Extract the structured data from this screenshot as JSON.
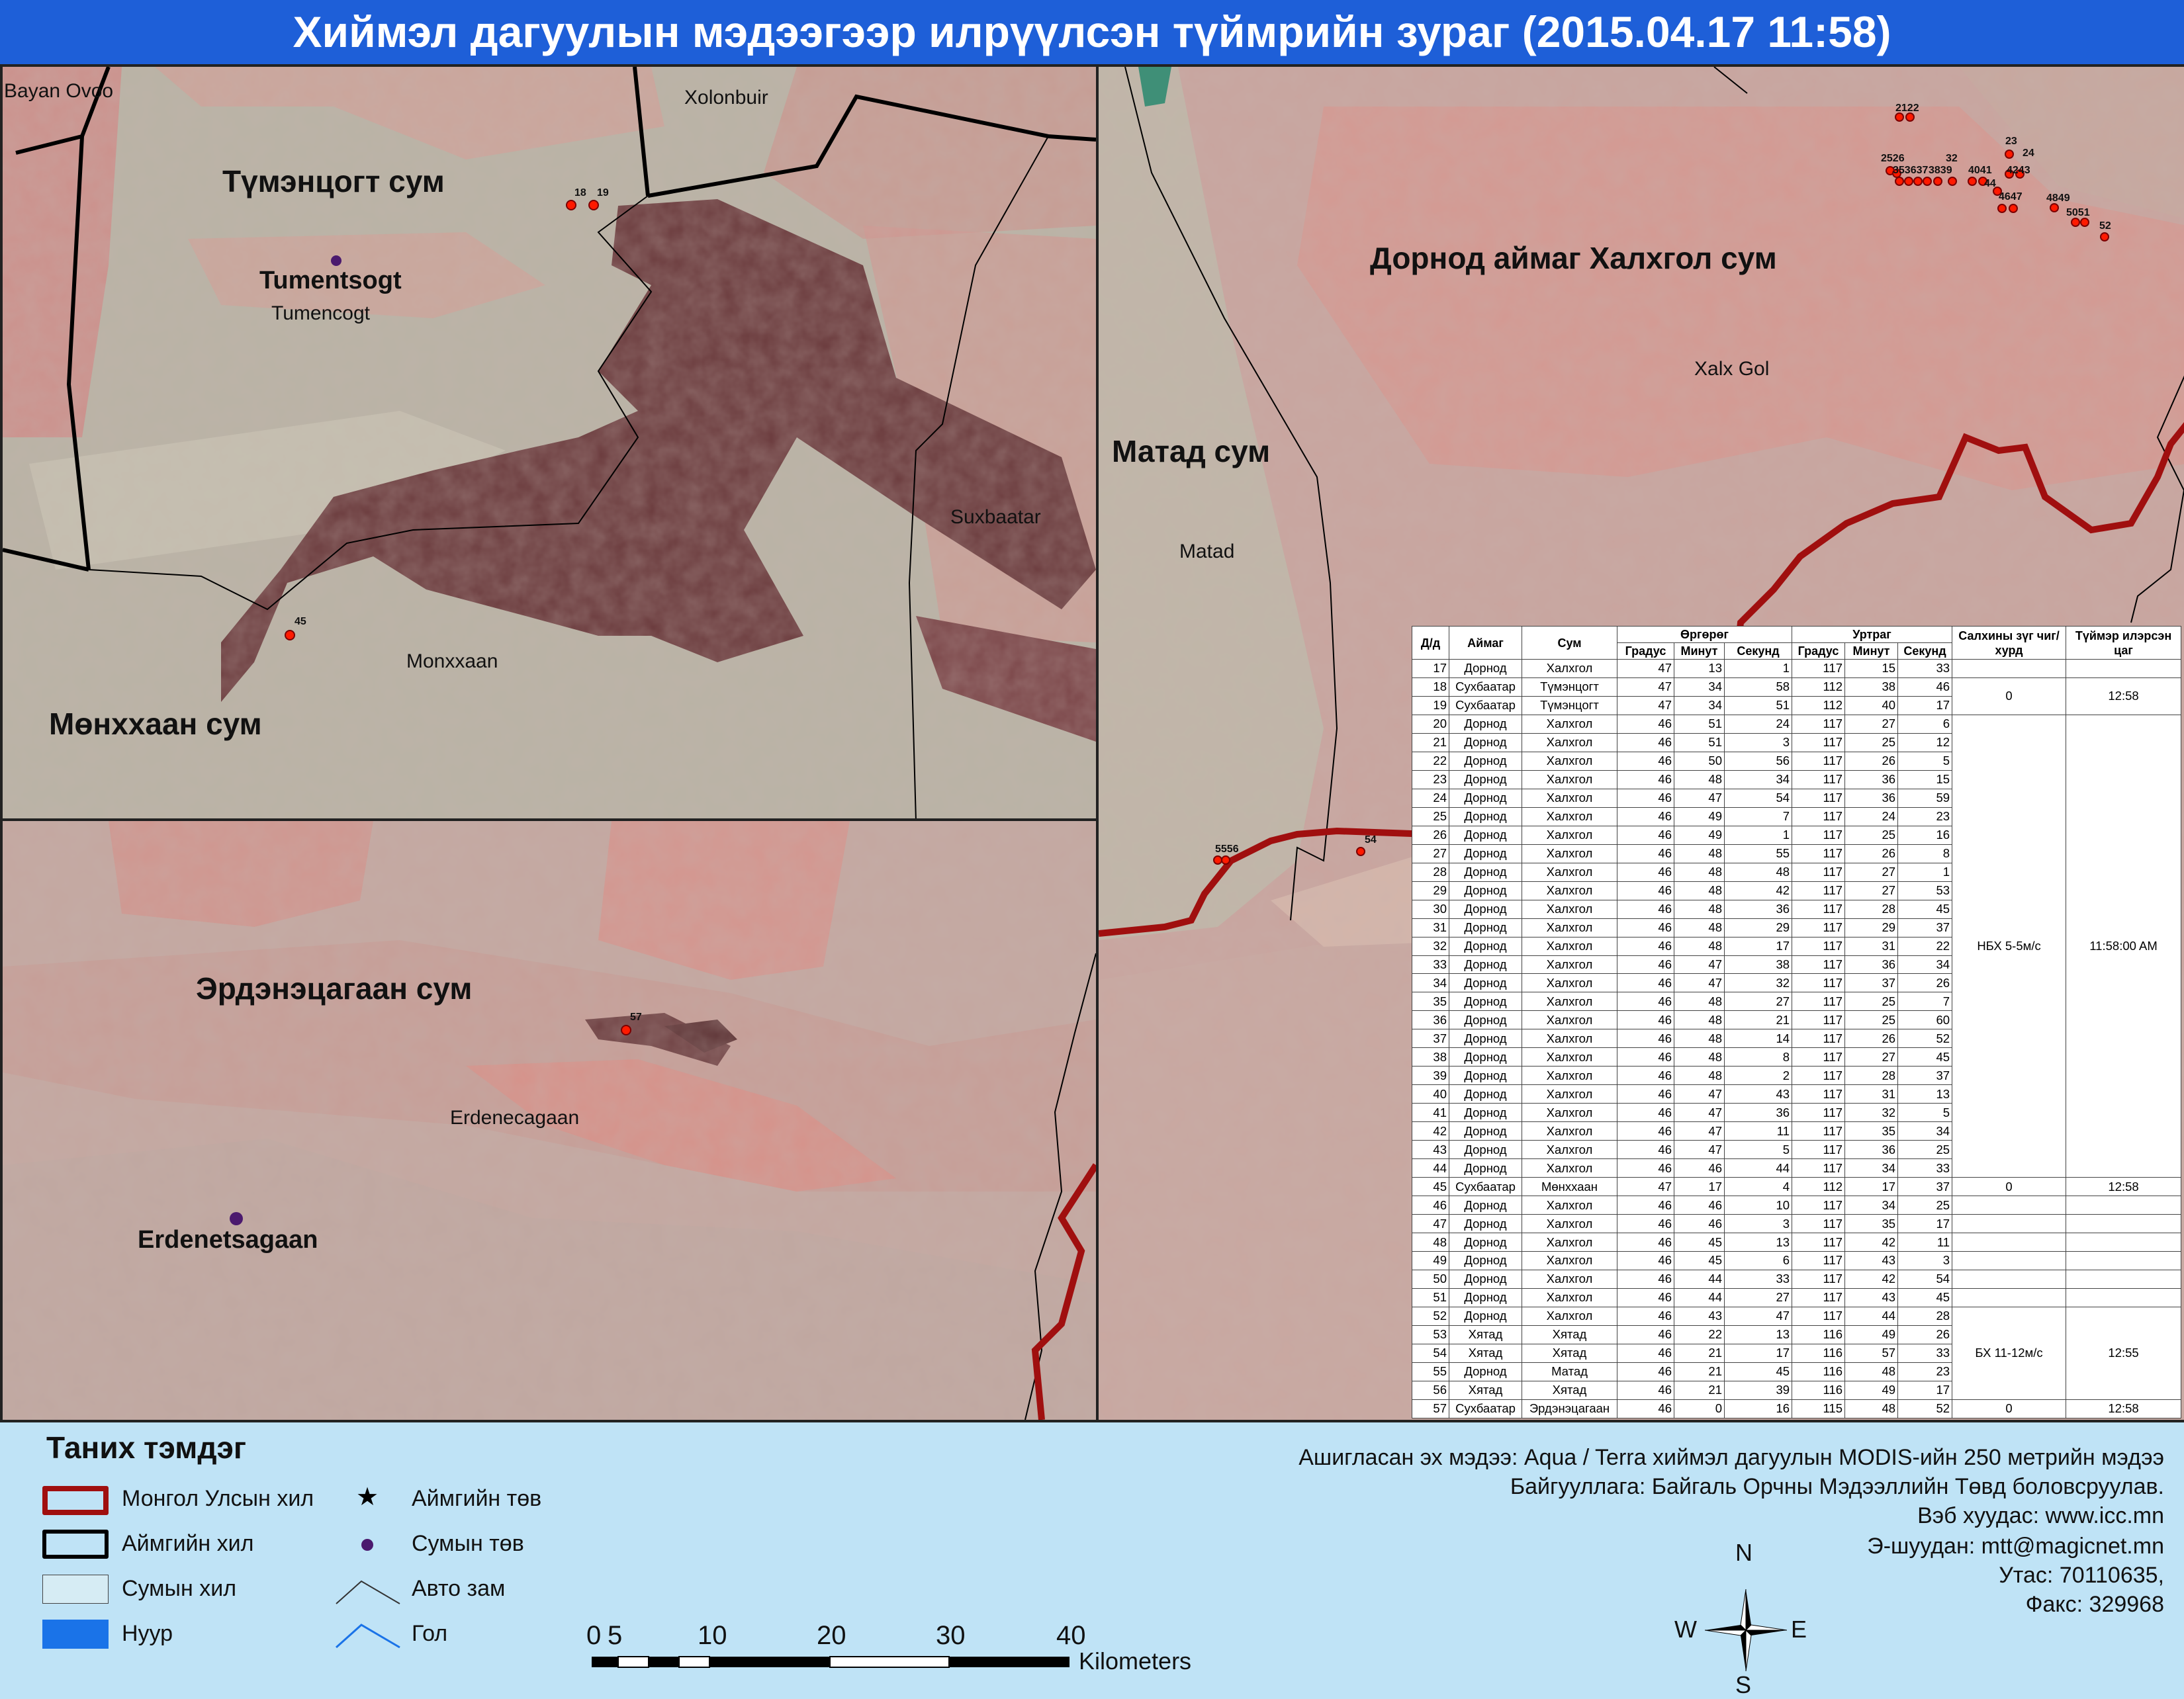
{
  "title": "Хиймэл дагуулын мэдээгээр илрүүлсэн түймрийн зураг  (2015.04.17 11:58)",
  "panel_tl": {
    "sum_tumentsogt": "Түмэнцогт сум",
    "sum_monkhkhaan": "Мөнххаан сум",
    "bayan_ovoo": "Bayan Ovoo",
    "xolonbuir": "Xolonbuir",
    "tumentsogt": "Tumentsogt",
    "tumencogt": "Tumencogt",
    "suxbaatar": "Suxbaatar",
    "monxxaan": "Monxxaan",
    "fires": [
      "18",
      "19",
      "45"
    ]
  },
  "panel_bl": {
    "sum_erdenetsagaan": "Эрдэнэцагаан сум",
    "erdenecagaan": "Erdenecagaan",
    "erdenetsagaan": "Erdenetsagaan",
    "fires": [
      "57"
    ]
  },
  "panel_r": {
    "sum_dornod": "Дорнод  аймаг Халхгол сум",
    "sum_matad": "Матад сум",
    "xalx_gol": "Xalx Gol",
    "matad": "Matad",
    "fires": [
      "2122",
      "2526",
      "353637",
      "3839",
      "32",
      "4041",
      "23",
      "24",
      "4243",
      "44",
      "4647",
      "4849",
      "5051",
      "52",
      "5556",
      "54"
    ]
  },
  "table": {
    "headers": {
      "dd": "Д/д",
      "aimag": "Аймаг",
      "sum": "Сум",
      "lat": "Өргөрөг",
      "lon": "Уртраг",
      "deg": "Градус",
      "min": "Минут",
      "sec": "Секунд",
      "wind": "Салхины зүг чиг/хурд",
      "time": "Түймэр илэрсэн цаг"
    },
    "rows": [
      [
        "17",
        "Дорнод",
        "Халхгол",
        "47",
        "13",
        "1",
        "117",
        "15",
        "33"
      ],
      [
        "18",
        "Сухбаатар",
        "Түмэнцогт",
        "47",
        "34",
        "58",
        "112",
        "38",
        "46"
      ],
      [
        "19",
        "Сухбаатар",
        "Түмэнцогт",
        "47",
        "34",
        "51",
        "112",
        "40",
        "17"
      ],
      [
        "20",
        "Дорнод",
        "Халхгол",
        "46",
        "51",
        "24",
        "117",
        "27",
        "6"
      ],
      [
        "21",
        "Дорнод",
        "Халхгол",
        "46",
        "51",
        "3",
        "117",
        "25",
        "12"
      ],
      [
        "22",
        "Дорнод",
        "Халхгол",
        "46",
        "50",
        "56",
        "117",
        "26",
        "5"
      ],
      [
        "23",
        "Дорнод",
        "Халхгол",
        "46",
        "48",
        "34",
        "117",
        "36",
        "15"
      ],
      [
        "24",
        "Дорнод",
        "Халхгол",
        "46",
        "47",
        "54",
        "117",
        "36",
        "59"
      ],
      [
        "25",
        "Дорнод",
        "Халхгол",
        "46",
        "49",
        "7",
        "117",
        "24",
        "23"
      ],
      [
        "26",
        "Дорнод",
        "Халхгол",
        "46",
        "49",
        "1",
        "117",
        "25",
        "16"
      ],
      [
        "27",
        "Дорнод",
        "Халхгол",
        "46",
        "48",
        "55",
        "117",
        "26",
        "8"
      ],
      [
        "28",
        "Дорнод",
        "Халхгол",
        "46",
        "48",
        "48",
        "117",
        "27",
        "1"
      ],
      [
        "29",
        "Дорнод",
        "Халхгол",
        "46",
        "48",
        "42",
        "117",
        "27",
        "53"
      ],
      [
        "30",
        "Дорнод",
        "Халхгол",
        "46",
        "48",
        "36",
        "117",
        "28",
        "45"
      ],
      [
        "31",
        "Дорнод",
        "Халхгол",
        "46",
        "48",
        "29",
        "117",
        "29",
        "37"
      ],
      [
        "32",
        "Дорнод",
        "Халхгол",
        "46",
        "48",
        "17",
        "117",
        "31",
        "22"
      ],
      [
        "33",
        "Дорнод",
        "Халхгол",
        "46",
        "47",
        "38",
        "117",
        "36",
        "34"
      ],
      [
        "34",
        "Дорнод",
        "Халхгол",
        "46",
        "47",
        "32",
        "117",
        "37",
        "26"
      ],
      [
        "35",
        "Дорнод",
        "Халхгол",
        "46",
        "48",
        "27",
        "117",
        "25",
        "7"
      ],
      [
        "36",
        "Дорнод",
        "Халхгол",
        "46",
        "48",
        "21",
        "117",
        "25",
        "60"
      ],
      [
        "37",
        "Дорнод",
        "Халхгол",
        "46",
        "48",
        "14",
        "117",
        "26",
        "52"
      ],
      [
        "38",
        "Дорнод",
        "Халхгол",
        "46",
        "48",
        "8",
        "117",
        "27",
        "45"
      ],
      [
        "39",
        "Дорнод",
        "Халхгол",
        "46",
        "48",
        "2",
        "117",
        "28",
        "37"
      ],
      [
        "40",
        "Дорнод",
        "Халхгол",
        "46",
        "47",
        "43",
        "117",
        "31",
        "13"
      ],
      [
        "41",
        "Дорнод",
        "Халхгол",
        "46",
        "47",
        "36",
        "117",
        "32",
        "5"
      ],
      [
        "42",
        "Дорнод",
        "Халхгол",
        "46",
        "47",
        "11",
        "117",
        "35",
        "34"
      ],
      [
        "43",
        "Дорнод",
        "Халхгол",
        "46",
        "47",
        "5",
        "117",
        "36",
        "25"
      ],
      [
        "44",
        "Дорнод",
        "Халхгол",
        "46",
        "46",
        "44",
        "117",
        "34",
        "33"
      ],
      [
        "45",
        "Сухбаатар",
        "Мөнххаан",
        "47",
        "17",
        "4",
        "112",
        "17",
        "37"
      ],
      [
        "46",
        "Дорнод",
        "Халхгол",
        "46",
        "46",
        "10",
        "117",
        "34",
        "25"
      ],
      [
        "47",
        "Дорнод",
        "Халхгол",
        "46",
        "46",
        "3",
        "117",
        "35",
        "17"
      ],
      [
        "48",
        "Дорнод",
        "Халхгол",
        "46",
        "45",
        "13",
        "117",
        "42",
        "11"
      ],
      [
        "49",
        "Дорнод",
        "Халхгол",
        "46",
        "45",
        "6",
        "117",
        "43",
        "3"
      ],
      [
        "50",
        "Дорнод",
        "Халхгол",
        "46",
        "44",
        "33",
        "117",
        "42",
        "54"
      ],
      [
        "51",
        "Дорнод",
        "Халхгол",
        "46",
        "44",
        "27",
        "117",
        "43",
        "45"
      ],
      [
        "52",
        "Дорнод",
        "Халхгол",
        "46",
        "43",
        "47",
        "117",
        "44",
        "28"
      ],
      [
        "53",
        "Хятад",
        "Хятад",
        "46",
        "22",
        "13",
        "116",
        "49",
        "26"
      ],
      [
        "54",
        "Хятад",
        "Хятад",
        "46",
        "21",
        "17",
        "116",
        "57",
        "33"
      ],
      [
        "55",
        "Дорнод",
        "Матад",
        "46",
        "21",
        "45",
        "116",
        "48",
        "23"
      ],
      [
        "56",
        "Хятад",
        "Хятад",
        "46",
        "21",
        "39",
        "116",
        "49",
        "17"
      ],
      [
        "57",
        "Сухбаатар",
        "Эрдэнэцагаан",
        "46",
        "0",
        "16",
        "115",
        "48",
        "52"
      ]
    ],
    "groups": [
      {
        "wind": "0",
        "time": "12:58"
      },
      {
        "wind": "НБХ 5-5м/с",
        "time": "11:58:00 AM"
      },
      {
        "wind": "0",
        "time": "12:58"
      },
      {
        "wind": "БХ 11-12м/с",
        "time": "12:55"
      },
      {
        "wind": "0",
        "time": "12:58"
      }
    ]
  },
  "legend": {
    "title": "Таних тэмдэг",
    "items": [
      "Монгол Улсын хил",
      "Аймгийн хил",
      "Сумын хил",
      "Нуур",
      "Аймгийн төв",
      "Сумын төв",
      "Авто зам",
      "Гол"
    ]
  },
  "scale": {
    "ticks": [
      "0",
      "5",
      "10",
      "20",
      "30",
      "40"
    ],
    "unit": "Kilometers"
  },
  "compass": {
    "n": "N",
    "s": "S",
    "e": "E",
    "w": "W"
  },
  "credits": [
    "Ашигласан эх мэдээ: Aqua / Terra хиймэл дагуулын MODIS-ийн 250 метрийн мэдээ",
    "Байгууллага: Байгаль Орчны Мэдээллийн Төвд боловсруулав.",
    "Вэб хуудас: www.icc.mn",
    "Э-шуудан: mtt@magicnet.mn",
    "Утас: 70110635,",
    "Факс: 329968"
  ],
  "colors": {
    "title_bg": "#1e5fd8",
    "legend_bg": "#bfe3f6",
    "fire": "#ff1a00",
    "national_border": "#a00f0f",
    "sum_center": "#4b1a6e",
    "lake": "#1a73e8"
  }
}
